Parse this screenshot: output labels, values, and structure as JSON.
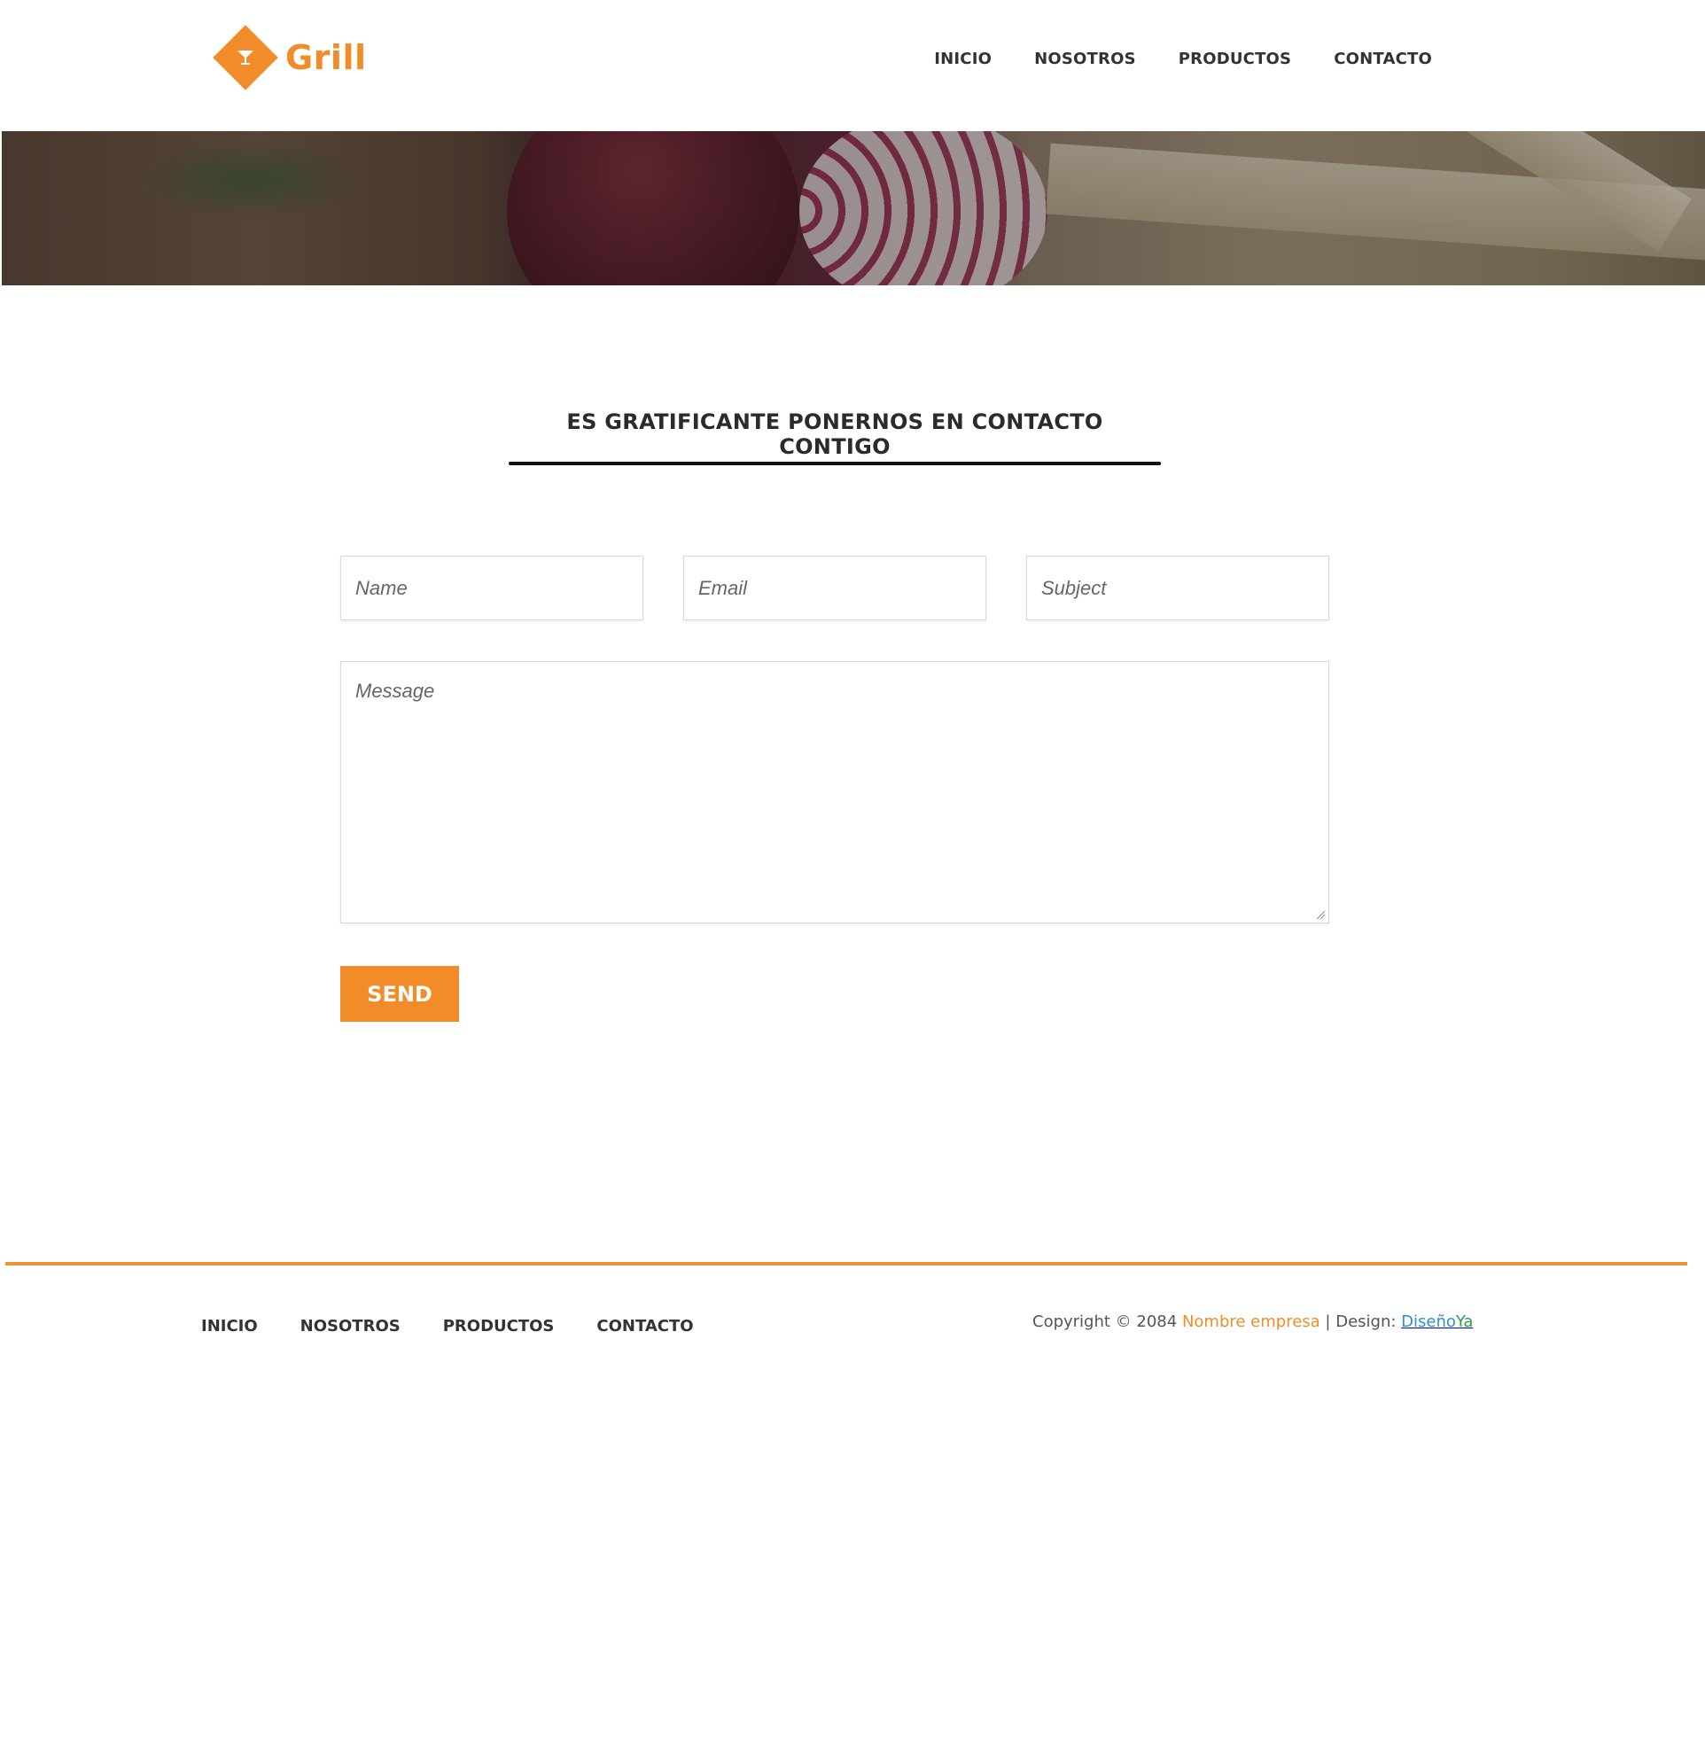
{
  "brand": {
    "name": "Grill",
    "color": "#f28c28",
    "icon": "cocktail-glass-icon"
  },
  "header": {
    "nav": [
      "INICIO",
      "NOSOTROS",
      "PRODUCTOS",
      "CONTACTO"
    ]
  },
  "banner": {
    "image": "vegetables-onion-banner"
  },
  "contact": {
    "title": "ES GRATIFICANTE PONERNOS EN CONTACTO CONTIGO",
    "name_placeholder": "Name",
    "email_placeholder": "Email",
    "subject_placeholder": "Subject",
    "message_placeholder": "Message",
    "send_label": "SEND"
  },
  "footer": {
    "nav": [
      "INICIO",
      "NOSOTROS",
      "PRODUCTOS",
      "CONTACTO"
    ],
    "copyright_prefix": "Copyright © 2084 ",
    "company": "Nombre empresa",
    "separator": " | Design: ",
    "design_part1": "Diseño",
    "design_part2": "Ya",
    "rule_color": "#e89632"
  }
}
